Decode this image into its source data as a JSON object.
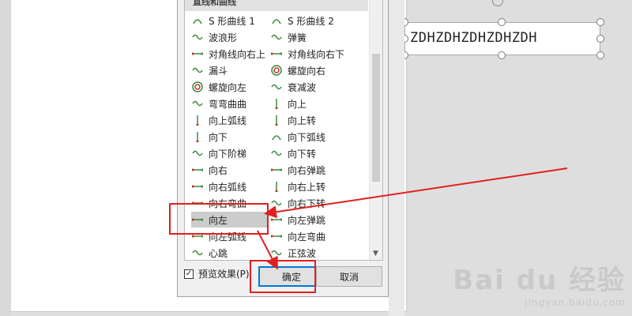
{
  "slide": {
    "textbox_text": "ZDHZDHZDHZDHZDH"
  },
  "dialog": {
    "group_header": "直线和曲线",
    "items": [
      {
        "label": "S 形曲线 1",
        "icon": "s-curve-1-icon"
      },
      {
        "label": "S 形曲线 2",
        "icon": "s-curve-2-icon"
      },
      {
        "label": "波浪形",
        "icon": "wave-icon"
      },
      {
        "label": "弹簧",
        "icon": "spring-icon"
      },
      {
        "label": "对角线向右上",
        "icon": "diagonal-up-right-icon"
      },
      {
        "label": "对角线向右下",
        "icon": "diagonal-down-right-icon"
      },
      {
        "label": "漏斗",
        "icon": "funnel-icon"
      },
      {
        "label": "螺旋向右",
        "icon": "spiral-right-icon"
      },
      {
        "label": "螺旋向左",
        "icon": "spiral-left-icon"
      },
      {
        "label": "衰减波",
        "icon": "decaying-wave-icon"
      },
      {
        "label": "弯弯曲曲",
        "icon": "zigzag-icon"
      },
      {
        "label": "向上",
        "icon": "up-icon"
      },
      {
        "label": "向上弧线",
        "icon": "arc-up-icon"
      },
      {
        "label": "向上转",
        "icon": "turn-up-icon"
      },
      {
        "label": "向下",
        "icon": "down-icon"
      },
      {
        "label": "向下弧线",
        "icon": "arc-down-icon"
      },
      {
        "label": "向下阶梯",
        "icon": "stairs-down-icon"
      },
      {
        "label": "向下转",
        "icon": "turn-down-icon"
      },
      {
        "label": "向右",
        "icon": "right-icon"
      },
      {
        "label": "向右弹跳",
        "icon": "bounce-right-icon"
      },
      {
        "label": "向右弧线",
        "icon": "arc-right-icon"
      },
      {
        "label": "向右上转",
        "icon": "turn-right-up-icon"
      },
      {
        "label": "向右弯曲",
        "icon": "curve-right-icon"
      },
      {
        "label": "向右下转",
        "icon": "turn-right-down-icon"
      },
      {
        "label": "向左",
        "icon": "left-icon"
      },
      {
        "label": "向左弹跳",
        "icon": "bounce-left-icon"
      },
      {
        "label": "向左弧线",
        "icon": "arc-left-icon"
      },
      {
        "label": "向左弯曲",
        "icon": "curve-left-icon"
      },
      {
        "label": "心跳",
        "icon": "heartbeat-icon"
      },
      {
        "label": "正弦波",
        "icon": "sine-wave-icon"
      }
    ],
    "selected_label": "向左",
    "preview_label": "预览效果(P)",
    "preview_checked": true,
    "ok_label": "确定",
    "cancel_label": "取消"
  },
  "watermark": {
    "brand": "Bai du 经验",
    "url": "jingyan.baidu.com"
  },
  "colors": {
    "annotation_red": "#e02020",
    "icon_green": "#3a8a3a",
    "icon_red": "#c03030",
    "ok_border": "#0078d7"
  }
}
